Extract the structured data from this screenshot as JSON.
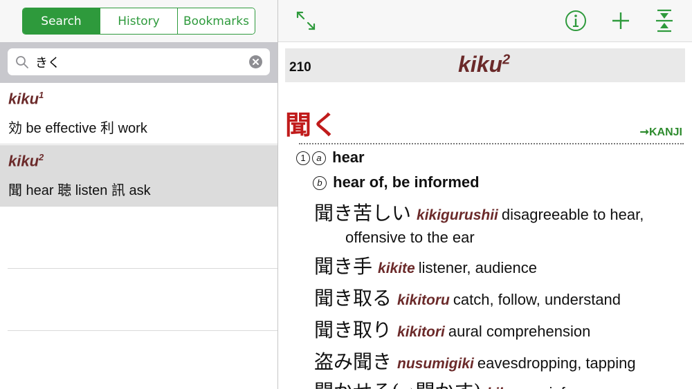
{
  "tabs": [
    {
      "label": "Search",
      "active": true
    },
    {
      "label": "History",
      "active": false
    },
    {
      "label": "Bookmarks",
      "active": false
    }
  ],
  "search": {
    "value": "きく",
    "icon": "search-icon",
    "clear_icon": "clear-icon"
  },
  "results": [
    {
      "romaji": "kiku",
      "sup": "1",
      "gloss": "効 be effective 利 work",
      "selected": false
    },
    {
      "romaji": "kiku",
      "sup": "2",
      "gloss": "聞 hear 聴 listen 訊 ask",
      "selected": true
    }
  ],
  "toolbar_icons": [
    "expand-icon",
    "info-icon",
    "add-icon",
    "collapse-icon"
  ],
  "colors": {
    "accent": "#2e9a3c",
    "headword": "#6b2a2a",
    "kana": "#c01b1b"
  },
  "detail": {
    "number": "210",
    "headword": "kiku",
    "headword_sup": "2",
    "kana": "聞く",
    "kanji_link": "➞KANJI",
    "senses": [
      {
        "marker1": "①",
        "marker2": "a",
        "text": "hear"
      },
      {
        "marker1": "",
        "marker2": "b",
        "text": "hear of, be informed"
      }
    ],
    "entries": [
      {
        "jp": "聞き苦しい",
        "romaji": "kikigurushii",
        "gloss": "disagreeable to hear,",
        "cont": "offensive to the ear"
      },
      {
        "jp": "聞き手",
        "romaji": "kikite",
        "gloss": "listener, audience"
      },
      {
        "jp": "聞き取る",
        "romaji": "kikitoru",
        "gloss": "catch, follow, understand"
      },
      {
        "jp": "聞き取り",
        "romaji": "kikitori",
        "gloss": "aural comprehension"
      },
      {
        "jp": "盗み聞き",
        "romaji": "nusumigiki",
        "gloss": "eavesdropping, tapping"
      },
      {
        "jp": "聞かせる(→聞かす)",
        "romaji": "kikaseru",
        "gloss": "inform"
      }
    ]
  }
}
